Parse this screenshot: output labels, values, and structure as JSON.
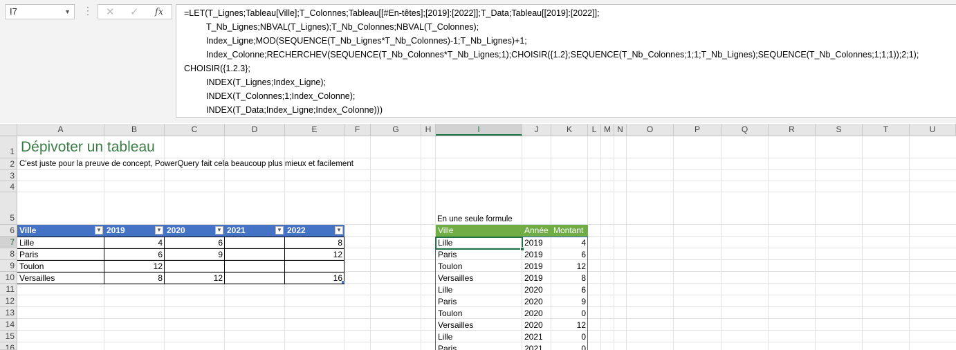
{
  "name_box": {
    "value": "I7"
  },
  "formula_bar": {
    "lines": [
      "=LET(T_Lignes;Tableau[Ville];T_Colonnes;Tableau[[#En-têtes];[2019]:[2022]];T_Data;Tableau[[2019]:[2022]];",
      "T_Nb_Lignes;NBVAL(T_Lignes);T_Nb_Colonnes;NBVAL(T_Colonnes);",
      "Index_Ligne;MOD(SEQUENCE(T_Nb_Lignes*T_Nb_Colonnes)-1;T_Nb_Lignes)+1;",
      "Index_Colonne;RECHERCHEV(SEQUENCE(T_Nb_Colonnes*T_Nb_Lignes;1);CHOISIR({1.2};SEQUENCE(T_Nb_Colonnes;1;1;T_Nb_Lignes);SEQUENCE(T_Nb_Colonnes;1;1;1));2;1);",
      "CHOISIR({1.2.3};",
      "INDEX(T_Lignes;Index_Ligne);",
      "INDEX(T_Colonnes;1;Index_Colonne);",
      "INDEX(T_Data;Index_Ligne;Index_Colonne)))"
    ]
  },
  "columns": [
    "A",
    "B",
    "C",
    "D",
    "E",
    "F",
    "G",
    "H",
    "I",
    "J",
    "K",
    "L",
    "M",
    "N",
    "O",
    "P",
    "Q",
    "R",
    "S",
    "T",
    "U"
  ],
  "rows": [
    "1",
    "2",
    "3",
    "4",
    "5",
    "6",
    "7",
    "8",
    "9",
    "10",
    "11",
    "12",
    "13",
    "14",
    "15",
    "16"
  ],
  "sheet": {
    "title": "Dépivoter un tableau",
    "subtitle": "C'est juste pour la preuve de concept, PowerQuery fait cela beaucoup plus mieux et facilement",
    "formula_label": "En une seule formule"
  },
  "source_table": {
    "headers": [
      "Ville",
      "2019",
      "2020",
      "2021",
      "2022"
    ],
    "rows": [
      [
        "Lille",
        "4",
        "6",
        "",
        "8"
      ],
      [
        "Paris",
        "6",
        "9",
        "",
        "12"
      ],
      [
        "Toulon",
        "12",
        "",
        "",
        ""
      ],
      [
        "Versailles",
        "8",
        "12",
        "",
        "16"
      ]
    ]
  },
  "result_table": {
    "headers": [
      "Ville",
      "Année",
      "Montant"
    ],
    "rows": [
      [
        "Lille",
        "2019",
        "4"
      ],
      [
        "Paris",
        "2019",
        "6"
      ],
      [
        "Toulon",
        "2019",
        "12"
      ],
      [
        "Versailles",
        "2019",
        "8"
      ],
      [
        "Lille",
        "2020",
        "6"
      ],
      [
        "Paris",
        "2020",
        "9"
      ],
      [
        "Toulon",
        "2020",
        "0"
      ],
      [
        "Versailles",
        "2020",
        "12"
      ],
      [
        "Lille",
        "2021",
        "0"
      ],
      [
        "Paris",
        "2021",
        "0"
      ]
    ]
  },
  "colors": {
    "table_header_blue": "#4472c4",
    "table_header_green": "#70ad47",
    "selection_green": "#217346"
  }
}
